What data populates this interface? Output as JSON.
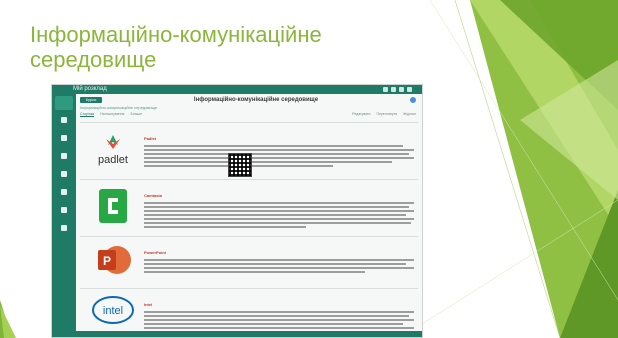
{
  "slide": {
    "title": "Інформаційно-комунікаційне середовище"
  },
  "app": {
    "brand": "Мій розклад",
    "page_heading": "Інформаційно-комунікаційне середовище",
    "course_button": "Курси",
    "course_name": "Інформаційно-комунікаційне середовище",
    "tabs": [
      "Сторінка",
      "Налаштування",
      "Більше"
    ],
    "actions": [
      "Редагувати",
      "Переглянути",
      "Журнал"
    ]
  },
  "rows": [
    {
      "tool": "padlet",
      "lead": "Padlet"
    },
    {
      "tool": "camtasia",
      "lead": "Camtasia"
    },
    {
      "tool": "powerpoint",
      "lead": "PowerPoint"
    },
    {
      "tool": "intel",
      "lead": "Intel"
    }
  ],
  "logos": {
    "padlet_text": "padlet",
    "intel_text": "intel"
  },
  "colors": {
    "accent_green": "#8ab73a",
    "moodle_teal": "#1f7a66"
  }
}
